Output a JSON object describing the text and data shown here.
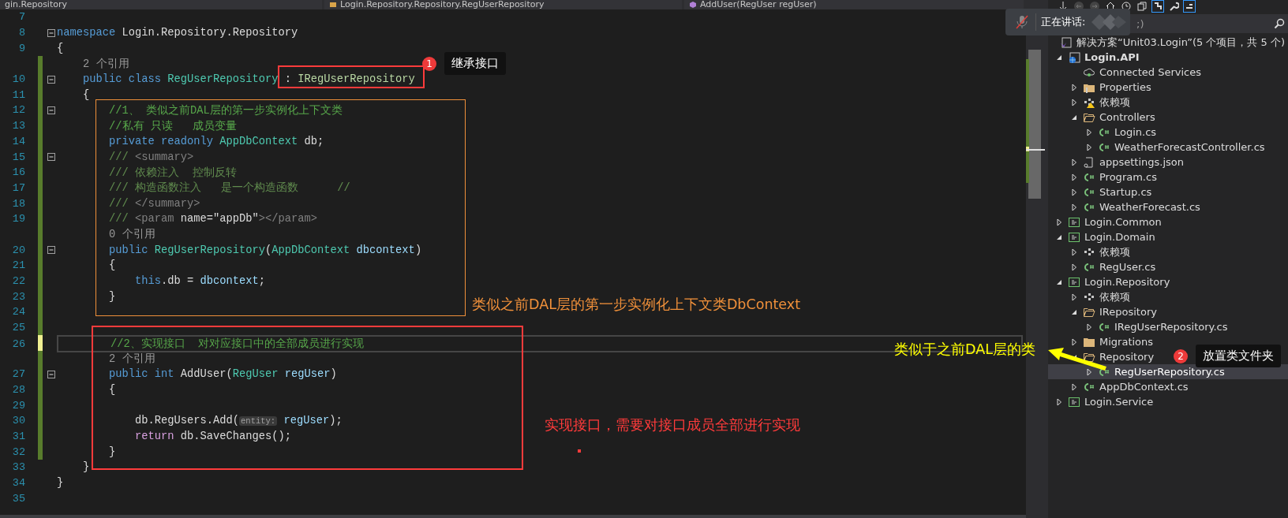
{
  "nav_bar": {
    "project": "gin.Repository",
    "class": "Login.Repository.Repository.RegUserRepository",
    "member": "AddUser(RegUser regUser)"
  },
  "editor": {
    "lines": [
      {
        "kind": "code",
        "num": "7",
        "fold": false,
        "modified": false,
        "current": false
      },
      {
        "kind": "code",
        "num": "8",
        "fold": true,
        "modified": false,
        "current": false,
        "tokens": [
          {
            "text": "namespace",
            "kind": "kw"
          },
          {
            "text": " Login.Repository.Repository",
            "kind": "plain"
          }
        ]
      },
      {
        "kind": "code",
        "num": "9",
        "fold": false,
        "modified": false,
        "current": false,
        "tokens": [
          {
            "text": "{",
            "kind": "plain"
          }
        ]
      },
      {
        "kind": "codelens",
        "text": "    2 个引用",
        "modified": true,
        "saved": true
      },
      {
        "kind": "code",
        "num": "10",
        "fold": true,
        "modified": true,
        "saved": true,
        "current": false,
        "tokens": [
          {
            "text": "    public",
            "kind": "kw"
          },
          {
            "text": " class",
            "kind": "kw"
          },
          {
            "text": " RegUserRepository",
            "kind": "type"
          },
          {
            "text": " : ",
            "kind": "plain"
          },
          {
            "text": "IRegUserRepository",
            "kind": "iface"
          }
        ]
      },
      {
        "kind": "code",
        "num": "11",
        "fold": false,
        "modified": true,
        "saved": true,
        "current": false,
        "tokens": [
          {
            "text": "    {",
            "kind": "plain"
          }
        ]
      },
      {
        "kind": "code",
        "num": "12",
        "fold": true,
        "modified": true,
        "saved": true,
        "current": false,
        "tokens": [
          {
            "text": "        //1、 类似之前DAL层的第一步实例化上下文类",
            "kind": "comment"
          }
        ]
      },
      {
        "kind": "code",
        "num": "13",
        "fold": false,
        "modified": true,
        "saved": true,
        "current": false,
        "tokens": [
          {
            "text": "        //私有 只读   成员变量",
            "kind": "comment"
          }
        ]
      },
      {
        "kind": "code",
        "num": "14",
        "fold": false,
        "modified": true,
        "saved": true,
        "current": false,
        "tokens": [
          {
            "text": "        private",
            "kind": "kw"
          },
          {
            "text": " readonly",
            "kind": "kw"
          },
          {
            "text": " AppDbContext",
            "kind": "type"
          },
          {
            "text": " db;",
            "kind": "plain"
          }
        ]
      },
      {
        "kind": "code",
        "num": "15",
        "fold": true,
        "modified": true,
        "saved": true,
        "current": false,
        "tokens": [
          {
            "text": "        /// ",
            "kind": "doc"
          },
          {
            "text": "<summary>",
            "kind": "xml"
          }
        ]
      },
      {
        "kind": "code",
        "num": "16",
        "fold": false,
        "modified": true,
        "saved": true,
        "current": false,
        "tokens": [
          {
            "text": "        /// 依赖注入  控制反转",
            "kind": "doc"
          }
        ]
      },
      {
        "kind": "code",
        "num": "17",
        "fold": false,
        "modified": true,
        "saved": true,
        "current": false,
        "tokens": [
          {
            "text": "        /// 构造函数注入   是一个构造函数      //",
            "kind": "doc"
          }
        ]
      },
      {
        "kind": "code",
        "num": "18",
        "fold": false,
        "modified": true,
        "saved": true,
        "current": false,
        "tokens": [
          {
            "text": "        /// ",
            "kind": "doc"
          },
          {
            "text": "</summary>",
            "kind": "xml"
          }
        ]
      },
      {
        "kind": "code",
        "num": "19",
        "fold": false,
        "modified": true,
        "saved": true,
        "current": false,
        "tokens": [
          {
            "text": "        /// ",
            "kind": "doc"
          },
          {
            "text": "<param",
            "kind": "xml"
          },
          {
            "text": " name=\"appDb\"",
            "kind": "plain"
          },
          {
            "text": "></param>",
            "kind": "xml"
          }
        ]
      },
      {
        "kind": "codelens",
        "text": "        0 个引用",
        "modified": true,
        "saved": true
      },
      {
        "kind": "code",
        "num": "20",
        "fold": true,
        "modified": true,
        "saved": true,
        "current": false,
        "tokens": [
          {
            "text": "        public",
            "kind": "kw"
          },
          {
            "text": " RegUserRepository",
            "kind": "type"
          },
          {
            "text": "(",
            "kind": "plain"
          },
          {
            "text": "AppDbContext",
            "kind": "type"
          },
          {
            "text": " dbcontext",
            "kind": "param"
          },
          {
            "text": ")",
            "kind": "plain"
          }
        ]
      },
      {
        "kind": "code",
        "num": "21",
        "fold": false,
        "modified": true,
        "saved": true,
        "current": false,
        "tokens": [
          {
            "text": "        {",
            "kind": "plain"
          }
        ]
      },
      {
        "kind": "code",
        "num": "22",
        "fold": false,
        "modified": true,
        "saved": true,
        "current": false,
        "tokens": [
          {
            "text": "            this",
            "kind": "kw"
          },
          {
            "text": ".db = ",
            "kind": "plain"
          },
          {
            "text": "dbcontext",
            "kind": "param"
          },
          {
            "text": ";",
            "kind": "plain"
          }
        ]
      },
      {
        "kind": "code",
        "num": "23",
        "fold": false,
        "modified": true,
        "saved": true,
        "current": false,
        "tokens": [
          {
            "text": "        }",
            "kind": "plain"
          }
        ]
      },
      {
        "kind": "code",
        "num": "24",
        "fold": false,
        "modified": true,
        "saved": true,
        "current": false
      },
      {
        "kind": "code",
        "num": "25",
        "fold": false,
        "modified": true,
        "saved": true,
        "current": false
      },
      {
        "kind": "code",
        "num": "26",
        "fold": false,
        "modified": true,
        "saved": false,
        "current": true,
        "tokens": [
          {
            "text": "        //2、实现接口  对对应接口中的全部成员进行实现",
            "kind": "comment"
          }
        ]
      },
      {
        "kind": "codelens",
        "text": "        2 个引用",
        "modified": true,
        "saved": true
      },
      {
        "kind": "code",
        "num": "27",
        "fold": true,
        "modified": true,
        "saved": true,
        "current": false,
        "tokens": [
          {
            "text": "        public",
            "kind": "kw"
          },
          {
            "text": " int",
            "kind": "kw"
          },
          {
            "text": " AddUser(",
            "kind": "plain"
          },
          {
            "text": "RegUser",
            "kind": "type"
          },
          {
            "text": " regUser",
            "kind": "param"
          },
          {
            "text": ")",
            "kind": "plain"
          }
        ]
      },
      {
        "kind": "code",
        "num": "28",
        "fold": false,
        "modified": true,
        "saved": true,
        "current": false,
        "tokens": [
          {
            "text": "        {",
            "kind": "plain"
          }
        ]
      },
      {
        "kind": "code",
        "num": "29",
        "fold": false,
        "modified": true,
        "saved": true,
        "current": false
      },
      {
        "kind": "code",
        "num": "30",
        "fold": false,
        "modified": true,
        "saved": true,
        "current": false,
        "tokens": [
          {
            "text": "            db.RegUsers.Add(",
            "kind": "plain"
          },
          {
            "text": "entity:",
            "kind": "inlay"
          },
          {
            "text": " regUser",
            "kind": "param"
          },
          {
            "text": ");",
            "kind": "plain"
          }
        ]
      },
      {
        "kind": "code",
        "num": "31",
        "fold": false,
        "modified": true,
        "saved": true,
        "current": false,
        "tokens": [
          {
            "text": "            return",
            "kind": "ctrl"
          },
          {
            "text": " db.SaveChanges();",
            "kind": "plain"
          }
        ]
      },
      {
        "kind": "code",
        "num": "32",
        "fold": false,
        "modified": true,
        "saved": true,
        "current": false,
        "tokens": [
          {
            "text": "        }",
            "kind": "plain"
          }
        ]
      },
      {
        "kind": "code",
        "num": "33",
        "fold": false,
        "modified": false,
        "current": false,
        "tokens": [
          {
            "text": "    }",
            "kind": "plain"
          }
        ]
      },
      {
        "kind": "code",
        "num": "34",
        "fold": false,
        "modified": false,
        "current": false,
        "tokens": [
          {
            "text": "}",
            "kind": "plain"
          }
        ]
      },
      {
        "kind": "code",
        "num": "35",
        "fold": false,
        "modified": false,
        "current": false
      }
    ]
  },
  "solution_explorer": {
    "search": {
      "placeholder": ";)"
    },
    "tree": [
      {
        "label": "解决方案“Unit03.Login”(5 个项目，共 5 个)",
        "kind": "solution",
        "selected": false,
        "children": [
          {
            "label": "Login.API",
            "kind": "web-project",
            "expanded": true,
            "startup": true,
            "selected": false,
            "children": [
              {
                "label": "Connected Services",
                "kind": "connected",
                "selected": false
              },
              {
                "label": "Properties",
                "kind": "properties",
                "expanded": false,
                "selected": false
              },
              {
                "label": "依赖项",
                "kind": "deps",
                "expanded": false,
                "warning": true,
                "selected": false
              },
              {
                "label": "Controllers",
                "kind": "folder",
                "expanded": true,
                "selected": false,
                "children": [
                  {
                    "label": "Login.cs",
                    "kind": "csharp",
                    "expanded": false,
                    "selected": false
                  },
                  {
                    "label": "WeatherForecastController.cs",
                    "kind": "csharp",
                    "expanded": false,
                    "selected": false
                  }
                ]
              },
              {
                "label": "appsettings.json",
                "kind": "json",
                "expanded": false,
                "selected": false
              },
              {
                "label": "Program.cs",
                "kind": "csharp",
                "expanded": false,
                "selected": false
              },
              {
                "label": "Startup.cs",
                "kind": "csharp",
                "expanded": false,
                "selected": false
              },
              {
                "label": "WeatherForecast.cs",
                "kind": "csharp",
                "expanded": false,
                "selected": false
              }
            ]
          },
          {
            "label": "Login.Common",
            "kind": "project",
            "expanded": false,
            "startup": false,
            "selected": false
          },
          {
            "label": "Login.Domain",
            "kind": "project",
            "expanded": true,
            "startup": false,
            "selected": false,
            "children": [
              {
                "label": "依赖项",
                "kind": "deps",
                "expanded": false,
                "warning": false,
                "selected": false
              },
              {
                "label": "RegUser.cs",
                "kind": "csharp",
                "expanded": false,
                "selected": false
              }
            ]
          },
          {
            "label": "Login.Repository",
            "kind": "project",
            "expanded": true,
            "startup": false,
            "selected": false,
            "children": [
              {
                "label": "依赖项",
                "kind": "deps",
                "expanded": false,
                "warning": false,
                "selected": false
              },
              {
                "label": "IRepository",
                "kind": "folder",
                "expanded": true,
                "selected": false,
                "children": [
                  {
                    "label": "IRegUserRepository.cs",
                    "kind": "csharp",
                    "expanded": false,
                    "selected": false
                  }
                ]
              },
              {
                "label": "Migrations",
                "kind": "folder",
                "expanded": false,
                "selected": false
              },
              {
                "label": "Repository",
                "kind": "folder",
                "expanded": true,
                "selected": false,
                "children": [
                  {
                    "label": "RegUserRepository.cs",
                    "kind": "csharp",
                    "expanded": false,
                    "selected": true
                  }
                ]
              },
              {
                "label": "AppDbContext.cs",
                "kind": "csharp",
                "expanded": false,
                "selected": false
              }
            ]
          },
          {
            "label": "Login.Service",
            "kind": "project",
            "expanded": false,
            "startup": false,
            "selected": false
          }
        ]
      }
    ]
  },
  "voice_popup": {
    "label": "正在讲话:"
  },
  "annotations": [
    {
      "kind": "frame",
      "color": "#ff3b3b"
    },
    {
      "kind": "callout",
      "number": "1",
      "text": "继承接口"
    },
    {
      "kind": "frame",
      "color": "#f0903a"
    },
    {
      "kind": "note",
      "text": "类似之前DAL层的第一步实例化上下文类DbContext",
      "color": "#f0903a"
    },
    {
      "kind": "frame",
      "color": "#ff3b3b"
    },
    {
      "kind": "note",
      "text": "实现接口，需要对接口成员全部进行实现",
      "color": "#ff3b3b"
    },
    {
      "kind": "dot",
      "color": "#ff3b3b"
    },
    {
      "kind": "note",
      "text": "类似于之前DAL层的类",
      "color": "#ffff00"
    },
    {
      "kind": "arrow",
      "color": "#ffff00"
    },
    {
      "kind": "callout",
      "number": "2",
      "text": "放置类文件夹"
    }
  ]
}
